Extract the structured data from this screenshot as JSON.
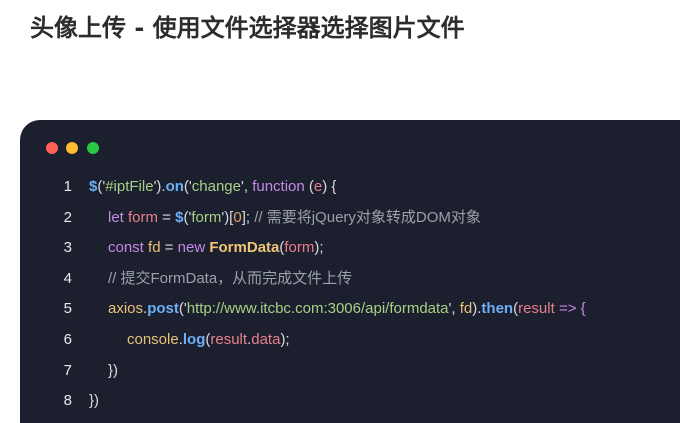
{
  "page": {
    "title": "头像上传 - 使用文件选择器选择图片文件"
  },
  "code_panel": {
    "window_dots": [
      {
        "name": "close",
        "color": "#ff5f57"
      },
      {
        "name": "minimize",
        "color": "#febc2e"
      },
      {
        "name": "maximize",
        "color": "#28c840"
      }
    ],
    "lines": [
      {
        "number": "1",
        "indent": 0,
        "tokens": [
          {
            "text": "$",
            "kind": "dollar"
          },
          {
            "text": "('",
            "kind": "plain"
          },
          {
            "text": "#iptFile",
            "kind": "str"
          },
          {
            "text": "').",
            "kind": "plain"
          },
          {
            "text": "on",
            "kind": "fn"
          },
          {
            "text": "('",
            "kind": "plain"
          },
          {
            "text": "change",
            "kind": "str"
          },
          {
            "text": "', ",
            "kind": "plain"
          },
          {
            "text": "function",
            "kind": "kw"
          },
          {
            "text": " (",
            "kind": "plain"
          },
          {
            "text": "e",
            "kind": "param"
          },
          {
            "text": ") {",
            "kind": "plain"
          }
        ]
      },
      {
        "number": "2",
        "indent": 1,
        "tokens": [
          {
            "text": "let",
            "kind": "kw"
          },
          {
            "text": " ",
            "kind": "plain"
          },
          {
            "text": "form",
            "kind": "param"
          },
          {
            "text": " = ",
            "kind": "plain"
          },
          {
            "text": "$",
            "kind": "dollar"
          },
          {
            "text": "('",
            "kind": "plain"
          },
          {
            "text": "form",
            "kind": "str"
          },
          {
            "text": "')[",
            "kind": "plain"
          },
          {
            "text": "0",
            "kind": "num"
          },
          {
            "text": "]; ",
            "kind": "plain"
          },
          {
            "text": "// 需要将jQuery对象转成DOM对象",
            "kind": "cmt"
          }
        ]
      },
      {
        "number": "3",
        "indent": 1,
        "tokens": [
          {
            "text": "const",
            "kind": "kw"
          },
          {
            "text": " ",
            "kind": "plain"
          },
          {
            "text": "fd",
            "kind": "var"
          },
          {
            "text": " = ",
            "kind": "plain"
          },
          {
            "text": "new",
            "kind": "kw"
          },
          {
            "text": " ",
            "kind": "plain"
          },
          {
            "text": "FormData",
            "kind": "cls"
          },
          {
            "text": "(",
            "kind": "plain"
          },
          {
            "text": "form",
            "kind": "param"
          },
          {
            "text": ");",
            "kind": "plain"
          }
        ]
      },
      {
        "number": "4",
        "indent": 1,
        "tokens": [
          {
            "text": "// 提交FormData，从而完成文件上传",
            "kind": "cmt"
          }
        ]
      },
      {
        "number": "5",
        "indent": 1,
        "tokens": [
          {
            "text": "axios",
            "kind": "var"
          },
          {
            "text": ".",
            "kind": "plain"
          },
          {
            "text": "post",
            "kind": "fn"
          },
          {
            "text": "('",
            "kind": "plain"
          },
          {
            "text": "http://www.itcbc.com:3006/api/formdata",
            "kind": "str"
          },
          {
            "text": "', ",
            "kind": "plain"
          },
          {
            "text": "fd",
            "kind": "var"
          },
          {
            "text": ").",
            "kind": "plain"
          },
          {
            "text": "then",
            "kind": "fn"
          },
          {
            "text": "(",
            "kind": "plain"
          },
          {
            "text": "result",
            "kind": "param"
          },
          {
            "text": " => {",
            "kind": "kw"
          }
        ]
      },
      {
        "number": "6",
        "indent": 2,
        "tokens": [
          {
            "text": "console",
            "kind": "var"
          },
          {
            "text": ".",
            "kind": "plain"
          },
          {
            "text": "log",
            "kind": "fn"
          },
          {
            "text": "(",
            "kind": "plain"
          },
          {
            "text": "result",
            "kind": "param"
          },
          {
            "text": ".",
            "kind": "plain"
          },
          {
            "text": "data",
            "kind": "param"
          },
          {
            "text": ");",
            "kind": "plain"
          }
        ]
      },
      {
        "number": "7",
        "indent": 1,
        "tokens": [
          {
            "text": "})",
            "kind": "plain"
          }
        ]
      },
      {
        "number": "8",
        "indent": 0,
        "tokens": [
          {
            "text": "})",
            "kind": "plain"
          }
        ]
      }
    ]
  }
}
